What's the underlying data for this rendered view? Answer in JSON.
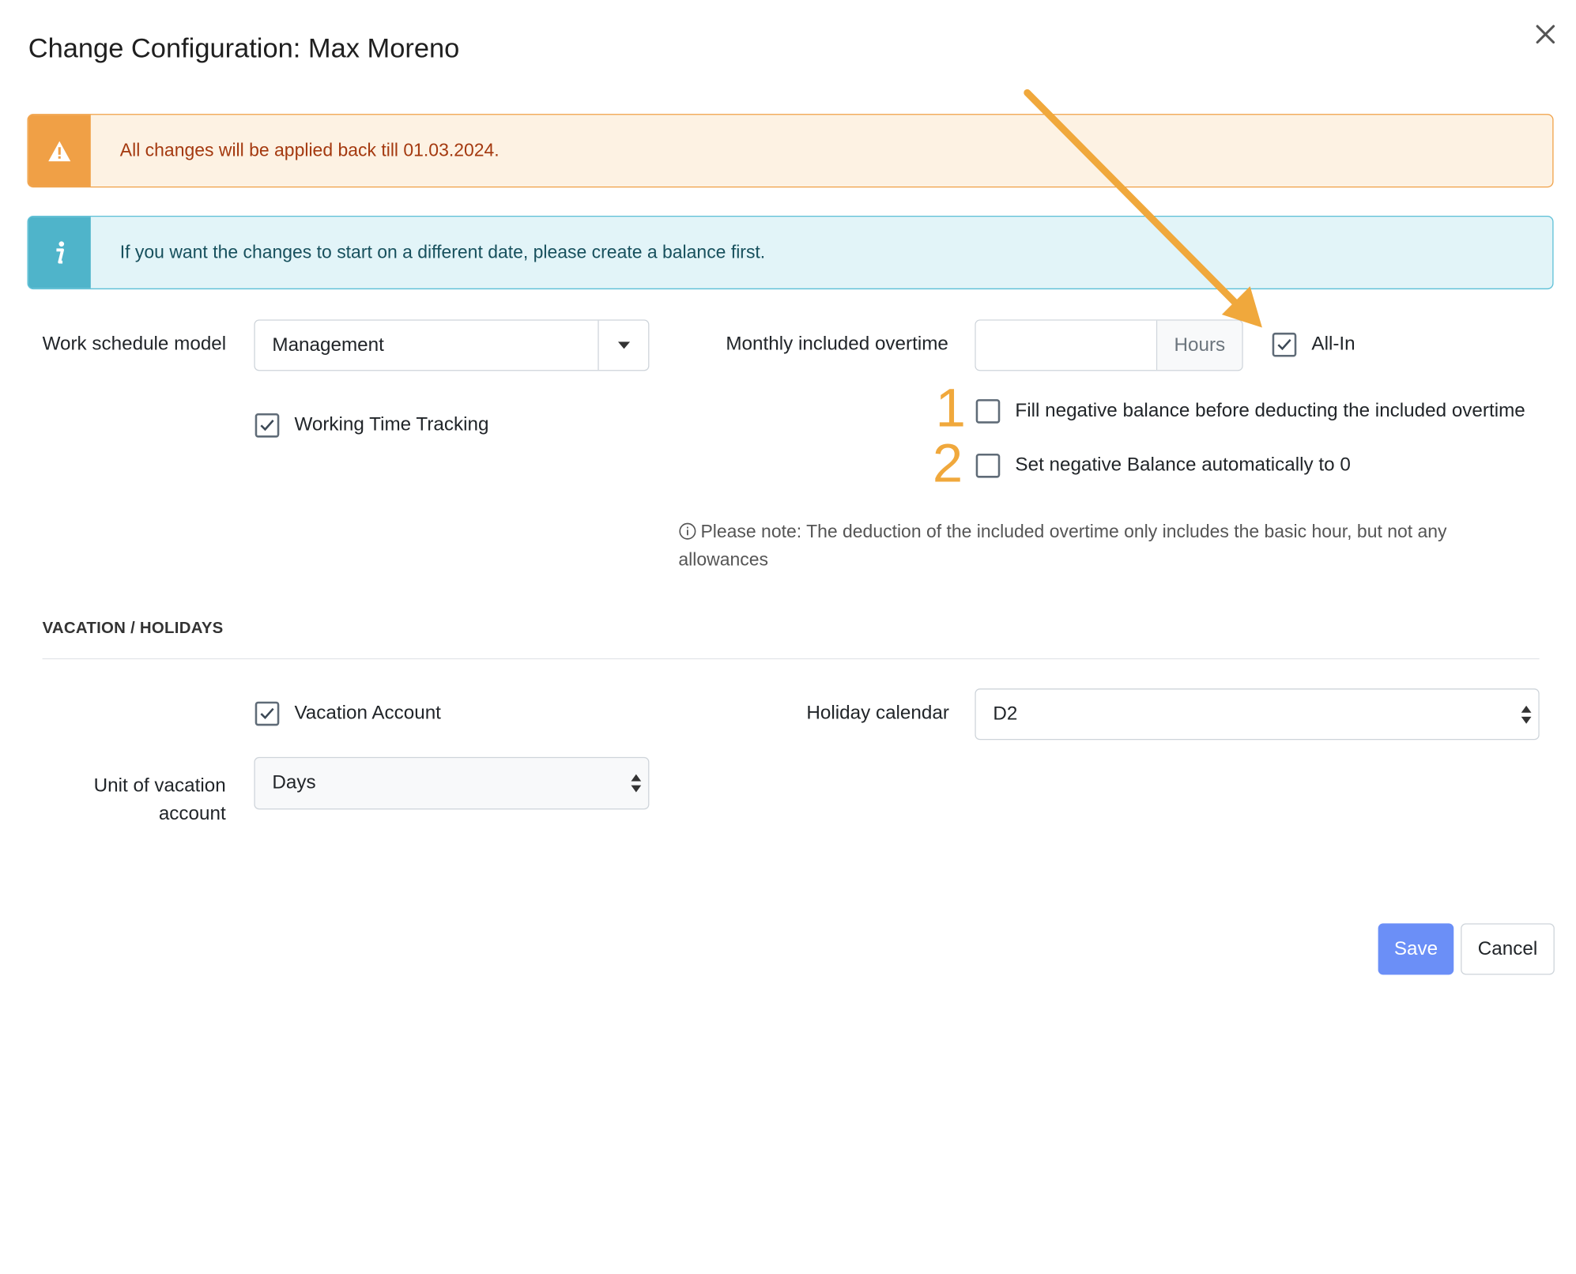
{
  "dialog": {
    "title": "Change Configuration: Max Moreno",
    "close_icon": "close-icon"
  },
  "alerts": {
    "warning": {
      "icon": "warning-triangle-icon",
      "text": "All changes will be applied back till 01.03.2024.",
      "color": "#f0a046"
    },
    "info": {
      "icon": "info-icon",
      "text": "If you want the changes to start on a different date, please create a balance first.",
      "color": "#4fb4ca"
    }
  },
  "work": {
    "schedule_label": "Work schedule model",
    "schedule_value": "Management",
    "tracking_label": "Working Time Tracking",
    "tracking_checked": true,
    "overtime_label": "Monthly included overtime",
    "overtime_value": "",
    "overtime_unit": "Hours",
    "all_in_label": "All-In",
    "all_in_checked": true,
    "fill_negative_label": "Fill negative balance before deducting the included overtime",
    "fill_negative_checked": false,
    "set_negative_label": "Set negative Balance automatically to 0",
    "set_negative_checked": false,
    "marker_1": "1",
    "marker_2": "2",
    "note": "Please note: The deduction of the included overtime only includes the basic hour, but not any allowances"
  },
  "vacation": {
    "section_title": "VACATION / HOLIDAYS",
    "account_label": "Vacation Account",
    "account_checked": true,
    "holiday_label": "Holiday calendar",
    "holiday_value": "D2",
    "unit_label_line1": "Unit of vacation",
    "unit_label_line2": "account",
    "unit_value": "Days"
  },
  "footer": {
    "save_label": "Save",
    "cancel_label": "Cancel"
  },
  "colors": {
    "accent": "#6b8ff7",
    "annotation": "#f0a83c"
  }
}
